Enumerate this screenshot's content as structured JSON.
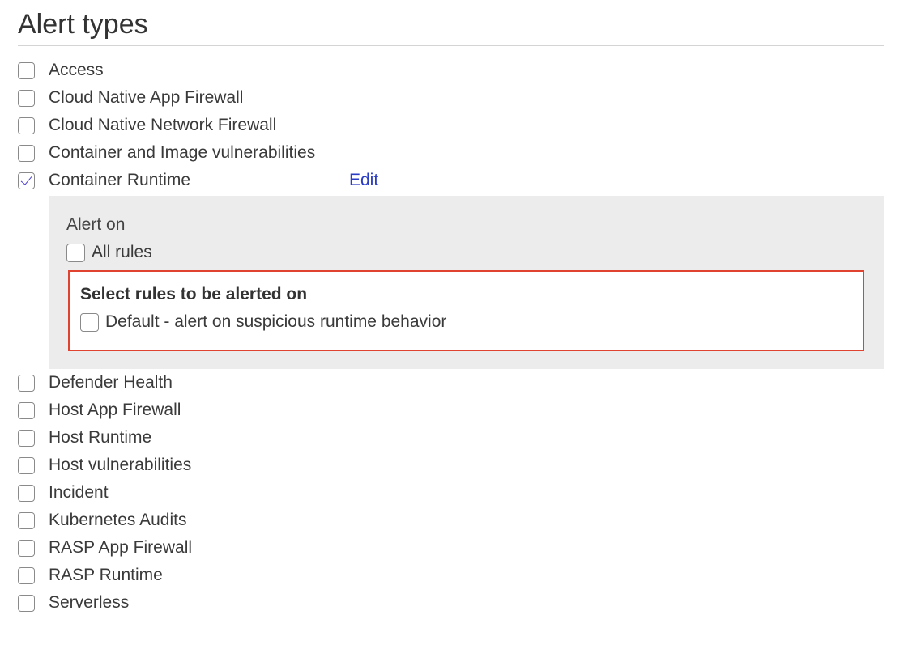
{
  "section": {
    "title": "Alert types"
  },
  "alert_types_before": [
    {
      "label": "Access",
      "checked": false
    },
    {
      "label": "Cloud Native App Firewall",
      "checked": false
    },
    {
      "label": "Cloud Native Network Firewall",
      "checked": false
    },
    {
      "label": "Container and Image vulnerabilities",
      "checked": false
    }
  ],
  "expanded_type": {
    "label": "Container Runtime",
    "checked": true,
    "edit_label": "Edit",
    "alert_on_label": "Alert on",
    "all_rules": {
      "label": "All rules",
      "checked": false
    },
    "rules_heading": "Select rules to be alerted on",
    "rules": [
      {
        "label": "Default - alert on suspicious runtime behavior",
        "checked": false
      }
    ]
  },
  "alert_types_after": [
    {
      "label": "Defender Health",
      "checked": false
    },
    {
      "label": "Host App Firewall",
      "checked": false
    },
    {
      "label": "Host Runtime",
      "checked": false
    },
    {
      "label": "Host vulnerabilities",
      "checked": false
    },
    {
      "label": "Incident",
      "checked": false
    },
    {
      "label": "Kubernetes Audits",
      "checked": false
    },
    {
      "label": "RASP App Firewall",
      "checked": false
    },
    {
      "label": "RASP Runtime",
      "checked": false
    },
    {
      "label": "Serverless",
      "checked": false
    }
  ],
  "colors": {
    "accent_check": "#4a3fd6",
    "link": "#2b3dc4",
    "highlight_border": "#e0432f",
    "panel_background": "#ececec"
  }
}
